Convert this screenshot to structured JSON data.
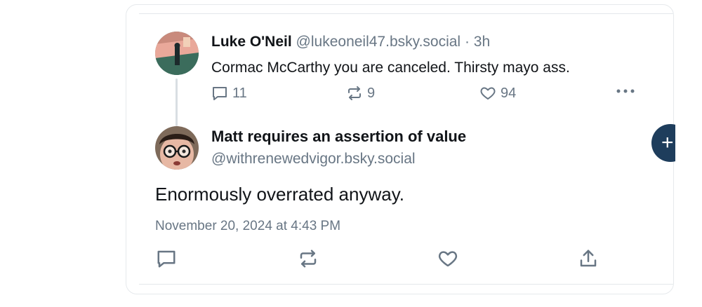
{
  "post": {
    "author_name": "Luke O'Neil",
    "author_handle": "@lukeoneil47.bsky.social",
    "separator": "·",
    "time_ago": "3h",
    "text": "Cormac McCarthy you are canceled. Thirsty mayo ass.",
    "reply_count": "11",
    "repost_count": "9",
    "like_count": "94"
  },
  "reply": {
    "author_name": "Matt requires an assertion of value",
    "author_handle": "@withrenewedvigor.bsky.social",
    "text": "Enormously overrated anyway.",
    "timestamp": "November 20, 2024 at 4:43 PM"
  },
  "fab": {
    "label": "+"
  },
  "icons": {
    "reply": "reply-icon",
    "repost": "repost-icon",
    "like": "heart-icon",
    "more": "more-icon",
    "share": "share-icon"
  },
  "colors": {
    "text": "#111418",
    "muted": "#687684",
    "fab": "#1e3d5c",
    "divider": "#e3e7eb"
  }
}
